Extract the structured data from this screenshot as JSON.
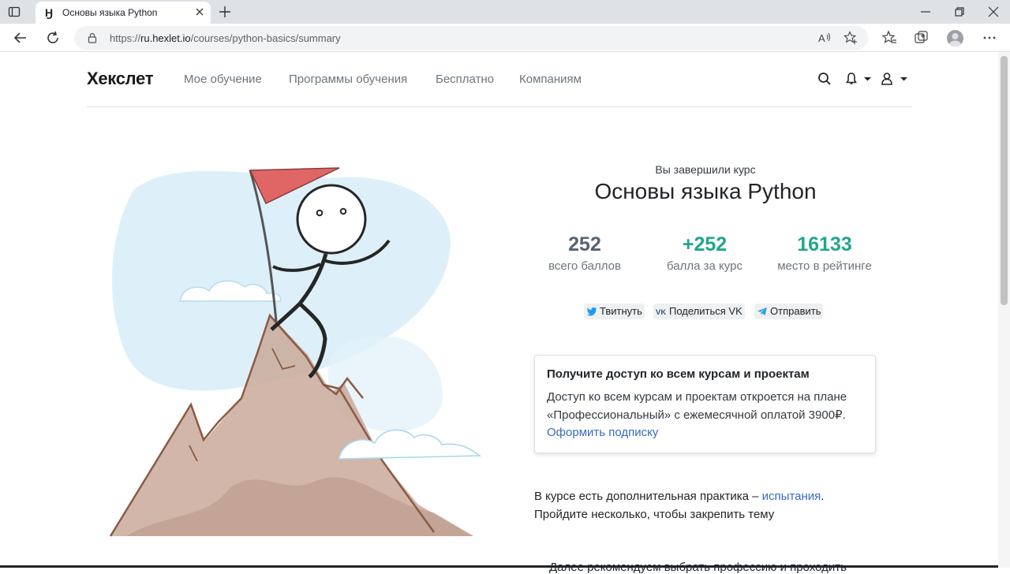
{
  "browser": {
    "tab_title": "Основы языка Python",
    "tab_favicon": "Ӈ",
    "url_prefix": "https://",
    "url_host": "ru.hexlet.io",
    "url_path": "/courses/python-basics/summary"
  },
  "site": {
    "logo": "Хекслет",
    "nav": [
      "Мое обучение",
      "Программы обучения",
      "Бесплатно",
      "Компаниям"
    ]
  },
  "summary": {
    "pre_title": "Вы завершили курс",
    "course_title": "Основы языка Python",
    "stats": [
      {
        "value": "252",
        "label": "всего баллов",
        "color": "#566272"
      },
      {
        "value": "+252",
        "label": "балла за курс",
        "color": "#20a68d"
      },
      {
        "value": "16133",
        "label": "место в рейтинге",
        "color": "#20a68d"
      }
    ],
    "share": {
      "twitter": "Твитнуть",
      "vk": "Поделиться VK",
      "telegram": "Отправить"
    },
    "card": {
      "title": "Получите доступ ко всем курсам и проектам",
      "text": "Доступ ко всем курсам и проектам откроется на плане «Профессиональный» с ежемесячной оплатой 3900₽.",
      "link": "Оформить подписку"
    },
    "extra": {
      "text_before": "В курсе есть дополнительная практика – ",
      "link": "испытания",
      "text_after": ".",
      "line2": "Пройдите несколько, чтобы закрепить тему"
    },
    "cut_line": "Далее рекомендуем выбрать профессию и проходить"
  }
}
